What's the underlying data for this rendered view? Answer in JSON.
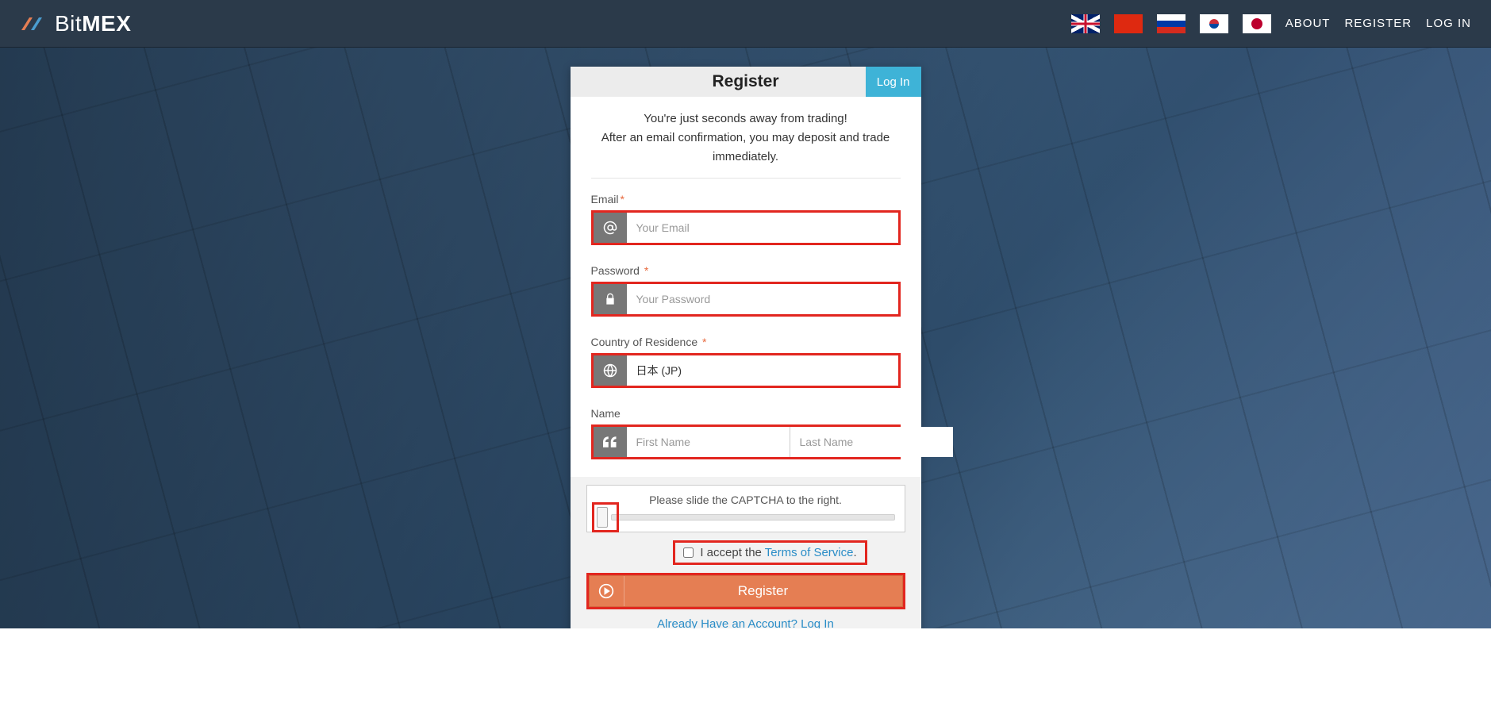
{
  "header": {
    "brand_pre": "Bit",
    "brand_bold": "MEX",
    "nav": {
      "about": "ABOUT",
      "register": "REGISTER",
      "login": "LOG IN"
    }
  },
  "card": {
    "title": "Register",
    "login_tab": "Log In",
    "intro_line1": "You're just seconds away from trading!",
    "intro_line2": "After an email confirmation, you may deposit and trade immediately.",
    "email_label": "Email",
    "email_placeholder": "Your Email",
    "password_label": "Password",
    "password_placeholder": "Your Password",
    "country_label": "Country of Residence",
    "country_value": "日本 (JP)",
    "name_label": "Name",
    "first_name_placeholder": "First Name",
    "last_name_placeholder": "Last Name",
    "captcha_text": "Please slide the CAPTCHA to the right.",
    "tos_pre": "I accept the ",
    "tos_link": "Terms of Service",
    "tos_post": ".",
    "register_button": "Register",
    "already_pre": "Already Have an Account? ",
    "already_link": "Log In"
  }
}
